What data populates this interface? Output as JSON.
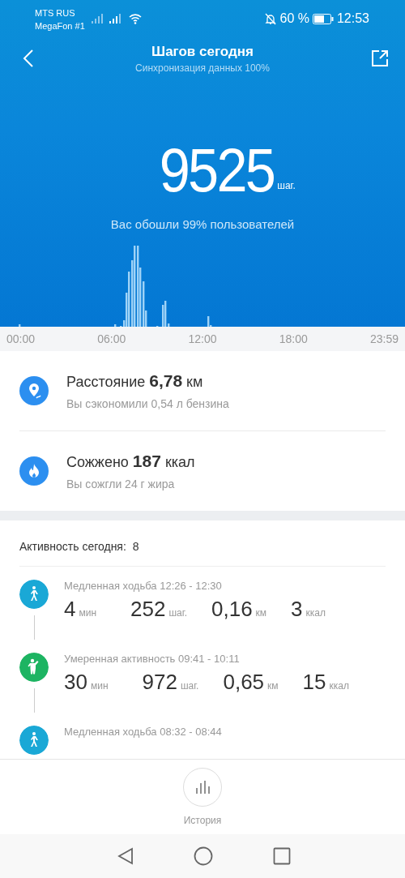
{
  "status_bar": {
    "carriers": [
      "MTS RUS",
      "MegaFon #1"
    ],
    "battery_text": "60 %",
    "time": "12:53"
  },
  "header": {
    "title": "Шагов сегодня",
    "subtitle": "Синхронизация данных 100%"
  },
  "summary": {
    "steps": "9525",
    "unit": "шаг.",
    "comparison": "Вас обошли 99% пользователей"
  },
  "timeline": {
    "labels": [
      "00:00",
      "06:00",
      "12:00",
      "18:00",
      "23:59"
    ]
  },
  "stats": [
    {
      "kind": "distance",
      "title": "Расстояние **6,78** км",
      "note": "Вы сэкономили 0,54 л бензина"
    },
    {
      "kind": "calories",
      "title": "Сожжено **187** ккал",
      "note": "Вы сожгли 24 г жира"
    }
  ],
  "activity": {
    "label": "Активность сегодня:",
    "count": "8",
    "items": [
      {
        "kind": "walk",
        "color": "#1aa8d6",
        "title": "Медленная ходьба 12:26 - 12:30",
        "metrics": [
          {
            "value": "4",
            "unit": "мин"
          },
          {
            "value": "252",
            "unit": "шаг."
          },
          {
            "value": "0,16",
            "unit": "км"
          },
          {
            "value": "3",
            "unit": "ккал"
          }
        ]
      },
      {
        "kind": "moderate",
        "color": "#1db462",
        "title": "Умеренная активность 09:41 - 10:11",
        "metrics": [
          {
            "value": "30",
            "unit": "мин"
          },
          {
            "value": "972",
            "unit": "шаг."
          },
          {
            "value": "0,65",
            "unit": "км"
          },
          {
            "value": "15",
            "unit": "ккал"
          }
        ]
      },
      {
        "kind": "walk",
        "color": "#1aa8d6",
        "title": "Медленная ходьба 08:32 - 08:44"
      }
    ]
  },
  "bottom": {
    "history_label": "История"
  }
}
